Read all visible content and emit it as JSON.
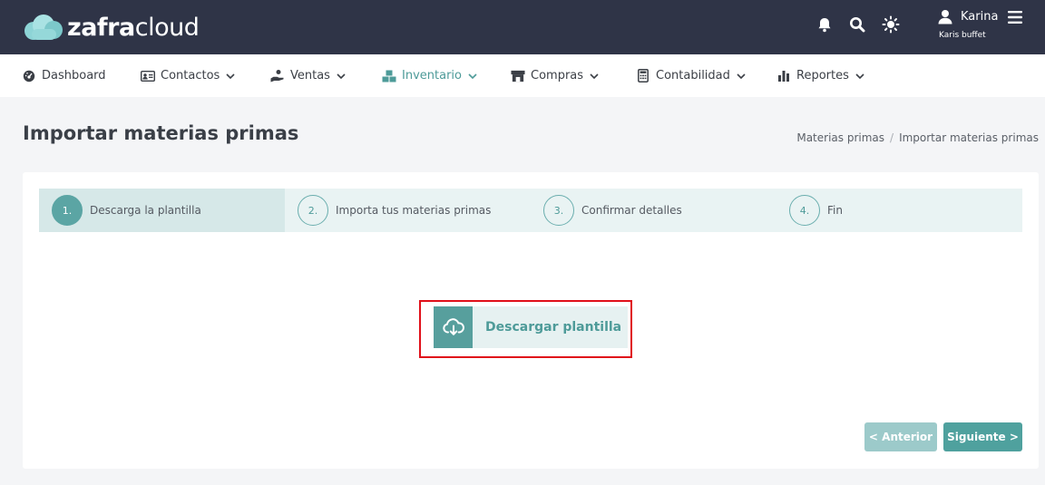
{
  "brand": {
    "name_bold": "zafra",
    "name_light": "cloud"
  },
  "header": {
    "user_name": "Karina",
    "user_sub": "Karis buffet",
    "icons": [
      "bell-icon",
      "search-icon",
      "sun-icon",
      "user-icon",
      "menu-icon"
    ]
  },
  "nav": {
    "items": [
      {
        "label": "Dashboard",
        "icon": "dashboard-icon"
      },
      {
        "label": "Contactos",
        "icon": "contact-card-icon"
      },
      {
        "label": "Ventas",
        "icon": "hand-coin-icon"
      },
      {
        "label": "Inventario",
        "icon": "boxes-icon"
      },
      {
        "label": "Compras",
        "icon": "store-icon"
      },
      {
        "label": "Contabilidad",
        "icon": "calculator-icon"
      },
      {
        "label": "Reportes",
        "icon": "bar-chart-icon"
      }
    ],
    "active": "Inventario"
  },
  "page": {
    "title": "Importar materias primas",
    "breadcrumb": [
      "Materias primas",
      "Importar materias primas"
    ]
  },
  "wizard": {
    "steps": [
      {
        "num": "1.",
        "label": "Descarga la plantilla"
      },
      {
        "num": "2.",
        "label": "Importa tus materias primas"
      },
      {
        "num": "3.",
        "label": "Confirmar detalles"
      },
      {
        "num": "4.",
        "label": "Fin"
      }
    ],
    "active_step": 1,
    "download_label": "Descargar plantilla",
    "prev_label": "< Anterior",
    "next_label": "Siguiente >"
  },
  "colors": {
    "header_bg": "#2f3447",
    "accent": "#4e9b99",
    "highlight": "#e0101a"
  }
}
